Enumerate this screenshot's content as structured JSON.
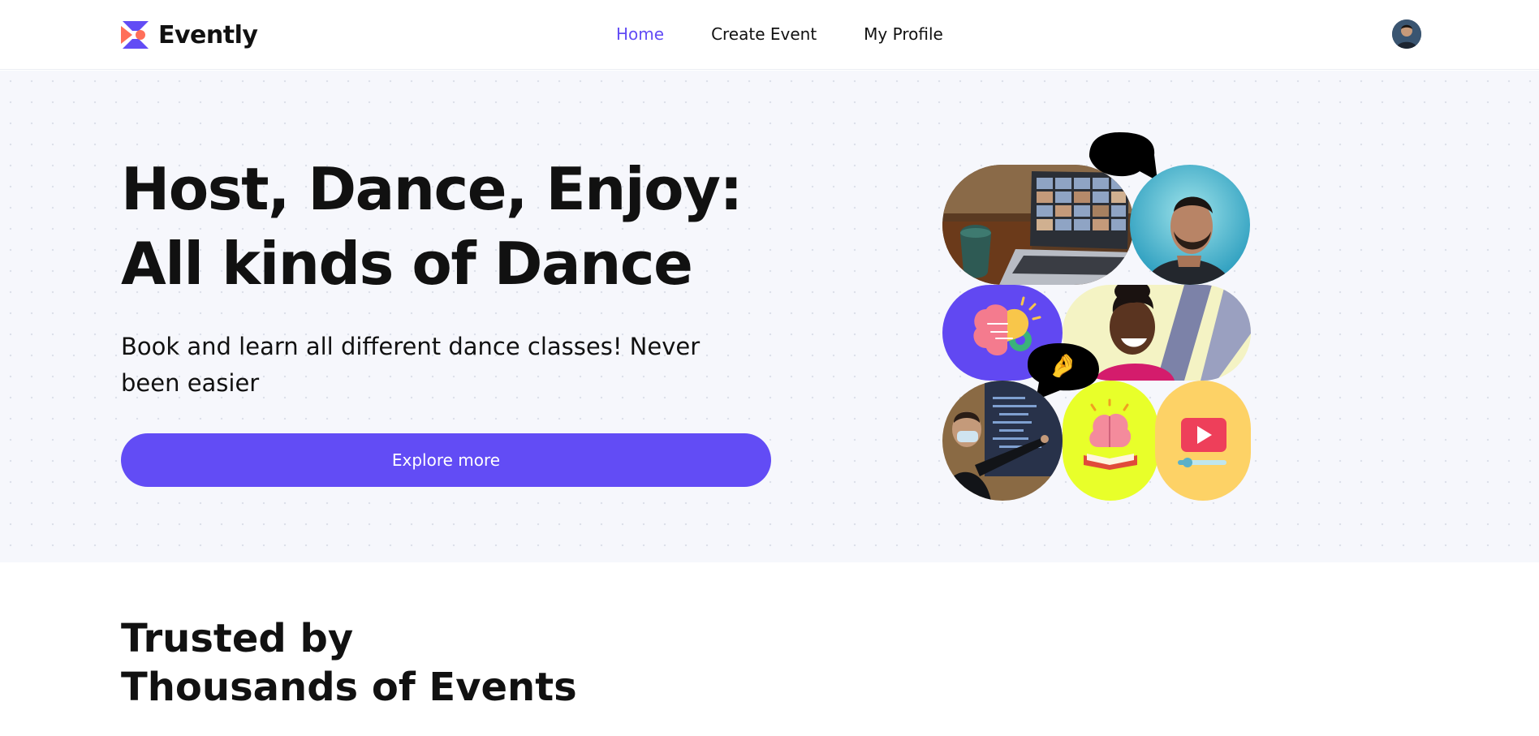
{
  "brand": {
    "name": "Evently",
    "accent_color": "#624cf5"
  },
  "nav": {
    "items": [
      {
        "label": "Home",
        "active": true
      },
      {
        "label": "Create Event",
        "active": false
      },
      {
        "label": "My Profile",
        "active": false
      }
    ]
  },
  "user": {
    "avatar_icon": "user-avatar"
  },
  "hero": {
    "title_line1": "Host, Dance, Enjoy:",
    "title_line2": "All kinds of Dance",
    "subtitle": "Book and learn all different dance classes! Never been easier",
    "cta_label": "Explore more",
    "collage": {
      "emoji_top": "😍",
      "emoji_middle": "🤌",
      "tiles": [
        "laptop-video-call-photo",
        "smiling-man-photo",
        "brain-gear-icon",
        "laughing-woman-photo",
        "presenter-photo",
        "brain-book-icon",
        "video-player-icon"
      ]
    }
  },
  "trusted": {
    "line1": "Trusted by",
    "line2": "Thousands of Events"
  }
}
